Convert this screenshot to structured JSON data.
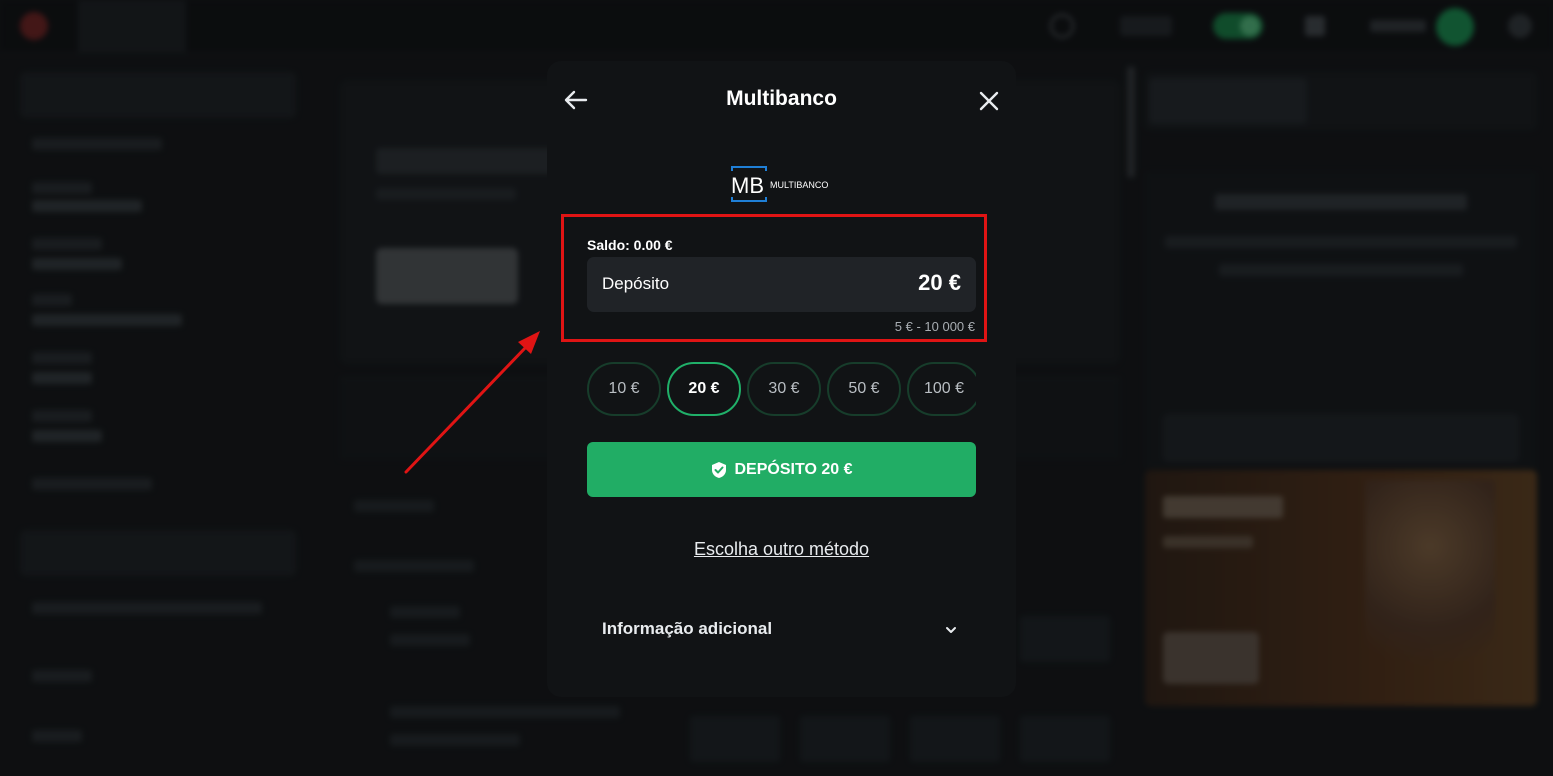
{
  "modal": {
    "title": "Multibanco",
    "logo": {
      "mark": "MB",
      "text": "MULTIBANCO"
    },
    "balance_label": "Saldo: 0.00 €",
    "deposit_field": {
      "label": "Depósito",
      "value": "20 €"
    },
    "limits": "5 € - 10 000 €",
    "amount_chips": [
      {
        "label": "10 €",
        "selected": false
      },
      {
        "label": "20 €",
        "selected": true
      },
      {
        "label": "30 €",
        "selected": false
      },
      {
        "label": "50 €",
        "selected": false
      },
      {
        "label": "100 €",
        "selected": false
      }
    ],
    "deposit_button": "DEPÓSITO 20 €",
    "other_method": "Escolha outro método",
    "additional_info": "Informação adicional"
  },
  "colors": {
    "accent_green": "#21ad65",
    "highlight_red": "#e01414",
    "modal_bg": "#111315"
  },
  "icons": [
    "arrow-left-icon",
    "close-icon",
    "shield-check-icon",
    "chevron-down-icon"
  ]
}
